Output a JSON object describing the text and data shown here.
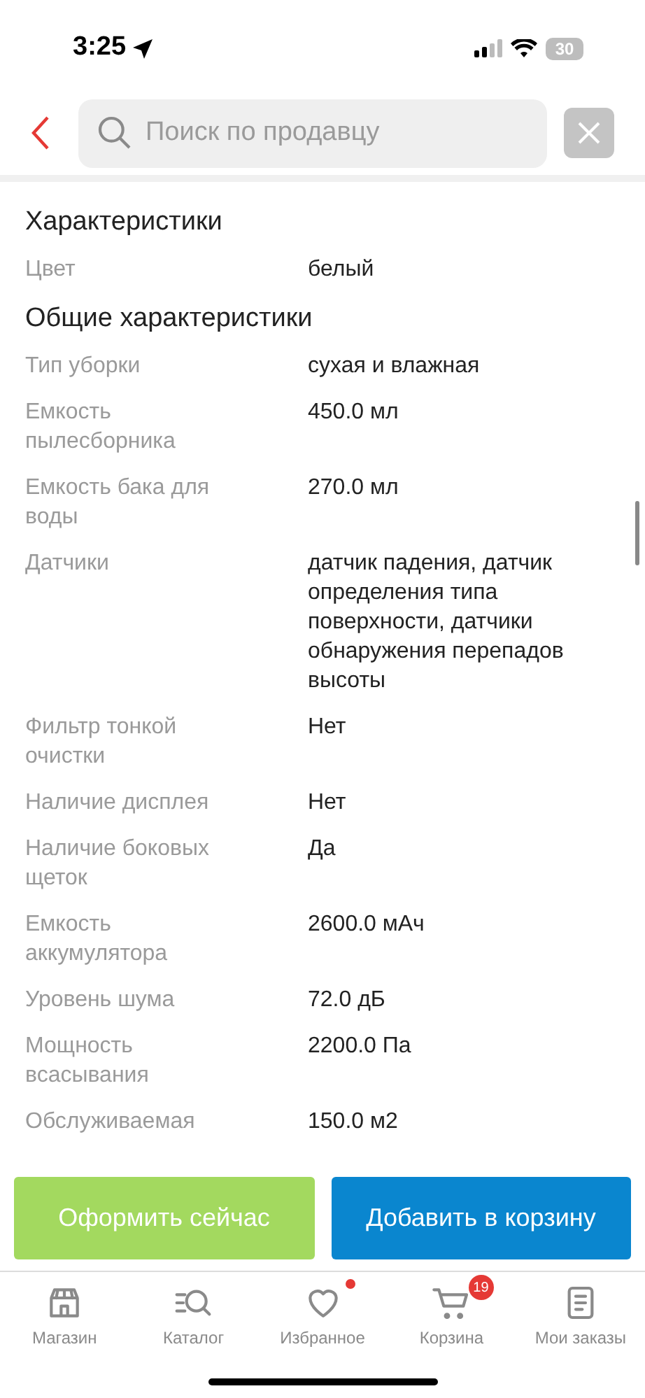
{
  "status_bar": {
    "time": "3:25",
    "battery": "30"
  },
  "header": {
    "search": {
      "placeholder": "Поиск по продавцу"
    }
  },
  "sections": [
    {
      "title": "Характеристики",
      "rows": [
        {
          "label": "Цвет",
          "value": "белый"
        }
      ]
    },
    {
      "title": "Общие характеристики",
      "rows": [
        {
          "label": "Тип уборки",
          "value": "сухая и влажная"
        },
        {
          "label": "Емкость пылесборника",
          "value": "450.0 мл"
        },
        {
          "label": "Емкость бака для воды",
          "value": "270.0 мл"
        },
        {
          "label": "Датчики",
          "value": "датчик падения, датчик определения типа поверхности, датчики обнаружения перепадов высоты"
        },
        {
          "label": "Фильтр тонкой очистки",
          "value": "Нет"
        },
        {
          "label": "Наличие дисплея",
          "value": "Нет"
        },
        {
          "label": "Наличие боковых щеток",
          "value": "Да"
        },
        {
          "label": "Емкость аккумулятора",
          "value": "2600.0 мАч"
        },
        {
          "label": "Уровень шума",
          "value": "72.0 дБ"
        },
        {
          "label": "Мощность всасывания",
          "value": "2200.0 Па"
        },
        {
          "label": "Обслуживаемая",
          "value": "150.0 м2"
        }
      ]
    }
  ],
  "actions": [
    {
      "kind": "primary",
      "label": "Оформить сейчас"
    },
    {
      "kind": "secondary",
      "label": "Добавить в корзину"
    }
  ],
  "tab_bar": [
    {
      "label": "Магазин",
      "dot": false
    },
    {
      "label": "Каталог",
      "dot": false
    },
    {
      "label": "Избранное",
      "dot": true
    },
    {
      "label": "Корзина",
      "dot": false,
      "badge": "19"
    },
    {
      "label": "Мои заказы",
      "dot": false
    }
  ]
}
